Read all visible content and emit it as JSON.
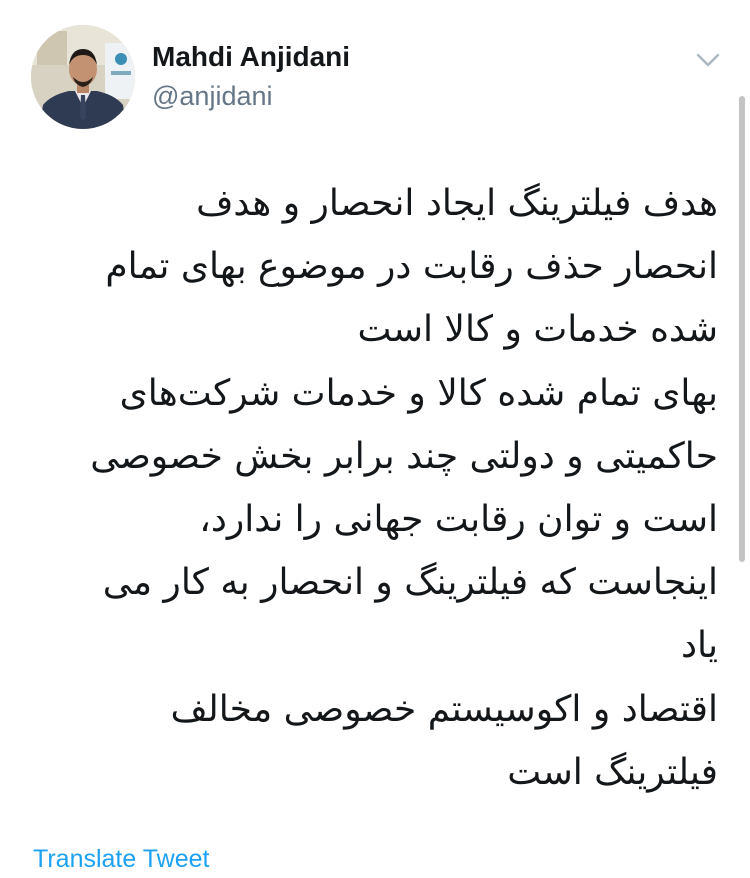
{
  "tweet": {
    "author": {
      "display_name": "Mahdi Anjidani",
      "handle": "@anjidani"
    },
    "menu_icon": "chevron-down-icon",
    "lines": [
      "هدف فیلترینگ ایجاد انحصار و هدف",
      "انحصار حذف رقابت در موضوع بهای تمام",
      "شده خدمات و کالا است",
      "بهای تمام شده کالا و خدمات شرکت‌های",
      "حاکمیتی و دولتی چند برابر بخش خصوصی",
      "است و توان رقابت جهانی را ندارد،",
      "اینجاست که فیلترینگ و انحصار به کار می",
      "یاد",
      "اقتصاد و اکوسیستم خصوصی مخالف",
      "فیلترینگ است"
    ],
    "translate_label": "Translate Tweet"
  },
  "colors": {
    "text": "#14171a",
    "secondary": "#657786",
    "link": "#1da1f2",
    "caret": "#aab8c2"
  }
}
